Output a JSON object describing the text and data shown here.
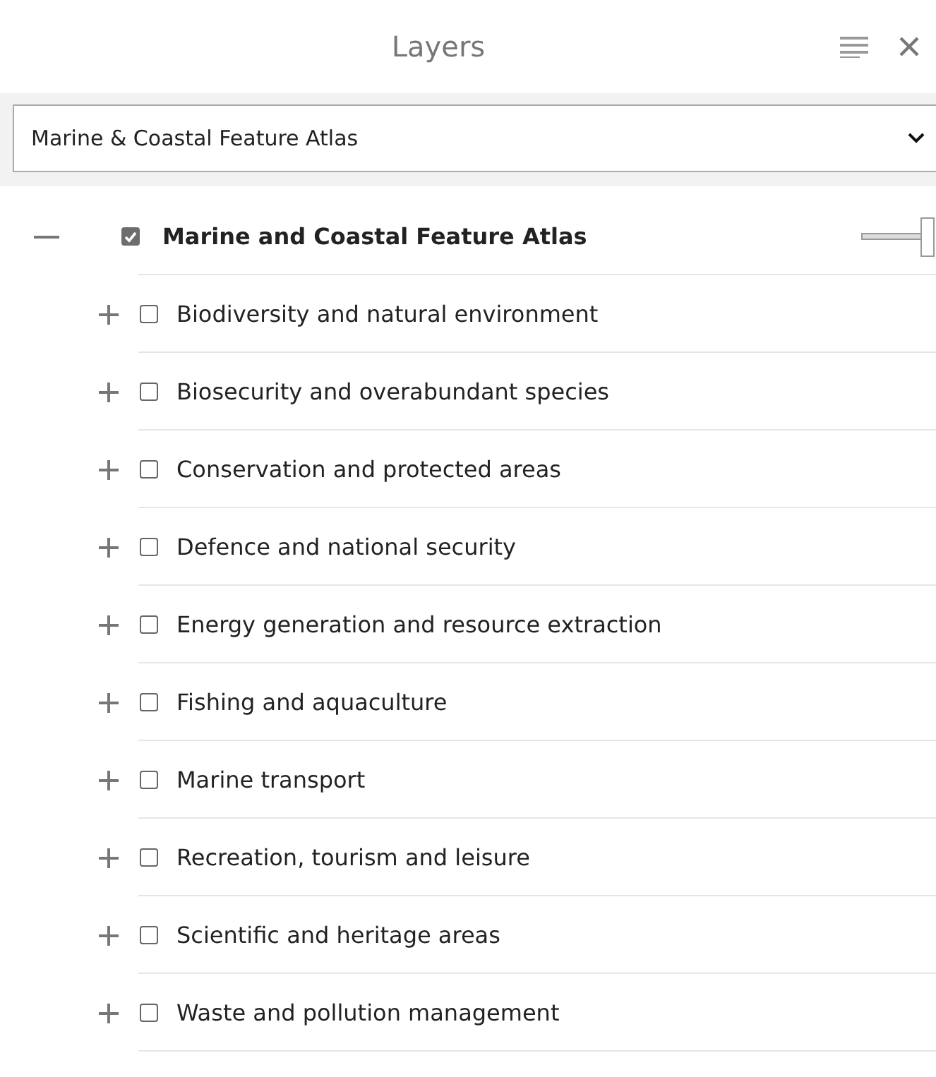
{
  "panel": {
    "title": "Layers"
  },
  "map_select": {
    "value": "Marine & Coastal Feature Atlas"
  },
  "tree": [
    {
      "label": "Marine and Coastal Feature Atlas",
      "expanded": true,
      "checked": true,
      "opacity": {
        "level": 1
      },
      "children": [
        {
          "label": "Biodiversity and natural environment",
          "expanded": false,
          "checked": false
        },
        {
          "label": "Biosecurity and overabundant species",
          "expanded": false,
          "checked": false
        },
        {
          "label": "Conservation and protected areas",
          "expanded": false,
          "checked": false
        },
        {
          "label": "Defence and national security",
          "expanded": false,
          "checked": false
        },
        {
          "label": "Energy generation and resource extraction",
          "expanded": false,
          "checked": false
        },
        {
          "label": "Fishing and aquaculture",
          "expanded": false,
          "checked": false
        },
        {
          "label": "Marine transport",
          "expanded": false,
          "checked": false
        },
        {
          "label": "Recreation, tourism and leisure",
          "expanded": false,
          "checked": false
        },
        {
          "label": "Scientific and heritage areas",
          "expanded": false,
          "checked": false
        },
        {
          "label": "Waste and pollution management",
          "expanded": false,
          "checked": false
        }
      ]
    }
  ]
}
